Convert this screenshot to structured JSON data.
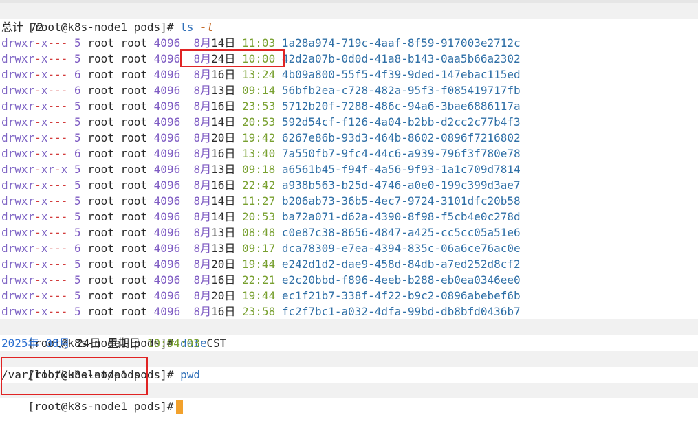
{
  "terminal": {
    "prompt": "[root@k8s-node1 pods]#",
    "cmd1": {
      "name": "ls",
      "flag": "-l"
    },
    "total": "总计 72",
    "entries": [
      {
        "perms": "drwxr-x---",
        "links": "5",
        "owner": "root",
        "group": "root",
        "size": "4096",
        "month": "8月",
        "day": "14日",
        "time": "11:03",
        "name": "1a28a974-719c-4aaf-8f59-917003e2712c"
      },
      {
        "perms": "drwxr-x---",
        "links": "5",
        "owner": "root",
        "group": "root",
        "size": "4096",
        "month": "8月",
        "day": "24日",
        "time": "10:00",
        "name": "42d2a07b-0d0d-41a8-b143-0aa5b66a2302"
      },
      {
        "perms": "drwxr-x---",
        "links": "6",
        "owner": "root",
        "group": "root",
        "size": "4096",
        "month": "8月",
        "day": "16日",
        "time": "13:24",
        "name": "4b09a800-55f5-4f39-9ded-147ebac115ed"
      },
      {
        "perms": "drwxr-x---",
        "links": "6",
        "owner": "root",
        "group": "root",
        "size": "4096",
        "month": "8月",
        "day": "13日",
        "time": "09:14",
        "name": "56bfb2ea-c728-482a-95f3-f085419717fb"
      },
      {
        "perms": "drwxr-x---",
        "links": "5",
        "owner": "root",
        "group": "root",
        "size": "4096",
        "month": "8月",
        "day": "16日",
        "time": "23:53",
        "name": "5712b20f-7288-486c-94a6-3bae6886117a"
      },
      {
        "perms": "drwxr-x---",
        "links": "5",
        "owner": "root",
        "group": "root",
        "size": "4096",
        "month": "8月",
        "day": "14日",
        "time": "20:53",
        "name": "592d54cf-f126-4a04-b2bb-d2cc2c77b4f3"
      },
      {
        "perms": "drwxr-x---",
        "links": "5",
        "owner": "root",
        "group": "root",
        "size": "4096",
        "month": "8月",
        "day": "20日",
        "time": "19:42",
        "name": "6267e86b-93d3-464b-8602-0896f7216802"
      },
      {
        "perms": "drwxr-x---",
        "links": "6",
        "owner": "root",
        "group": "root",
        "size": "4096",
        "month": "8月",
        "day": "16日",
        "time": "13:40",
        "name": "7a550fb7-9fc4-44c6-a939-796f3f780e78"
      },
      {
        "perms": "drwxr-xr-x",
        "links": "5",
        "owner": "root",
        "group": "root",
        "size": "4096",
        "month": "8月",
        "day": "13日",
        "time": "09:18",
        "name": "a6561b45-f94f-4a56-9f93-1a1c709d7814"
      },
      {
        "perms": "drwxr-x---",
        "links": "5",
        "owner": "root",
        "group": "root",
        "size": "4096",
        "month": "8月",
        "day": "16日",
        "time": "22:42",
        "name": "a938b563-b25d-4746-a0e0-199c399d3ae7"
      },
      {
        "perms": "drwxr-x---",
        "links": "5",
        "owner": "root",
        "group": "root",
        "size": "4096",
        "month": "8月",
        "day": "14日",
        "time": "11:27",
        "name": "b206ab73-36b5-4ec7-9724-3101dfc20b58"
      },
      {
        "perms": "drwxr-x---",
        "links": "5",
        "owner": "root",
        "group": "root",
        "size": "4096",
        "month": "8月",
        "day": "14日",
        "time": "20:53",
        "name": "ba72a071-d62a-4390-8f98-f5cb4e0c278d"
      },
      {
        "perms": "drwxr-x---",
        "links": "5",
        "owner": "root",
        "group": "root",
        "size": "4096",
        "month": "8月",
        "day": "13日",
        "time": "08:48",
        "name": "c0e87c38-8656-4847-a425-cc5cc05a51e6"
      },
      {
        "perms": "drwxr-x---",
        "links": "6",
        "owner": "root",
        "group": "root",
        "size": "4096",
        "month": "8月",
        "day": "13日",
        "time": "09:17",
        "name": "dca78309-e7ea-4394-835c-06a6ce76ac0e"
      },
      {
        "perms": "drwxr-x---",
        "links": "5",
        "owner": "root",
        "group": "root",
        "size": "4096",
        "month": "8月",
        "day": "20日",
        "time": "19:44",
        "name": "e242d1d2-dae9-458d-84db-a7ed252d8cf2"
      },
      {
        "perms": "drwxr-x---",
        "links": "5",
        "owner": "root",
        "group": "root",
        "size": "4096",
        "month": "8月",
        "day": "16日",
        "time": "22:21",
        "name": "e2c20bbd-f896-4eeb-b288-eb0ea0346ee0"
      },
      {
        "perms": "drwxr-x---",
        "links": "5",
        "owner": "root",
        "group": "root",
        "size": "4096",
        "month": "8月",
        "day": "20日",
        "time": "19:44",
        "name": "ec1f21b7-338f-4f22-b9c2-0896abebef6b"
      },
      {
        "perms": "drwxr-x---",
        "links": "5",
        "owner": "root",
        "group": "root",
        "size": "4096",
        "month": "8月",
        "day": "16日",
        "time": "23:58",
        "name": "fc2f7bc1-a032-4dfa-99bd-db8bfd0436b7"
      }
    ],
    "cmd2": "date",
    "date_output": {
      "year": "2025年",
      "month": "08月",
      "day": "24日",
      "weekday": "星期日",
      "clock": "10:04:03",
      "tz": "CST"
    },
    "cmd3": "pwd",
    "pwd_output": "/var/lib/kubelet/pods"
  }
}
